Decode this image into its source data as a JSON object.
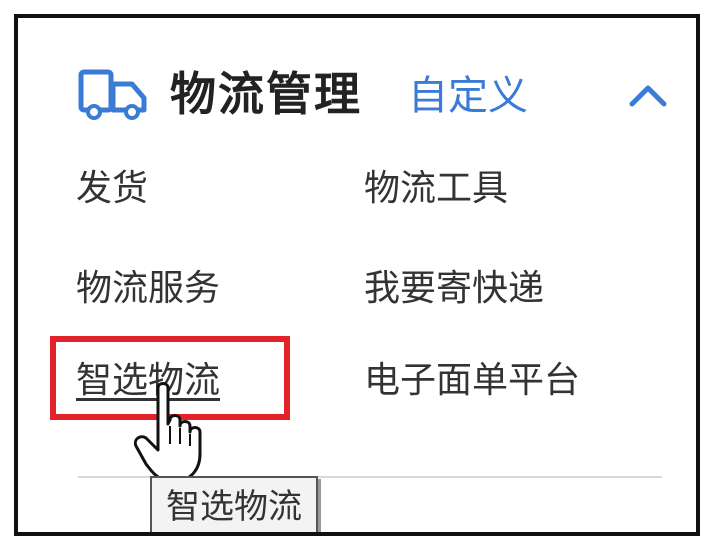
{
  "header": {
    "title": "物流管理",
    "customize_label": "自定义",
    "truck_icon": "truck-icon",
    "collapse_icon": "chevron-up-icon",
    "accent_color": "#3a7bd5"
  },
  "menu": {
    "items": [
      {
        "label": "发货"
      },
      {
        "label": "物流工具"
      },
      {
        "label": "物流服务"
      },
      {
        "label": "我要寄快递"
      },
      {
        "label": "智选物流"
      },
      {
        "label": "电子面单平台"
      }
    ]
  },
  "highlight_color": "#e3232c",
  "tooltip": {
    "text": "智选物流"
  }
}
